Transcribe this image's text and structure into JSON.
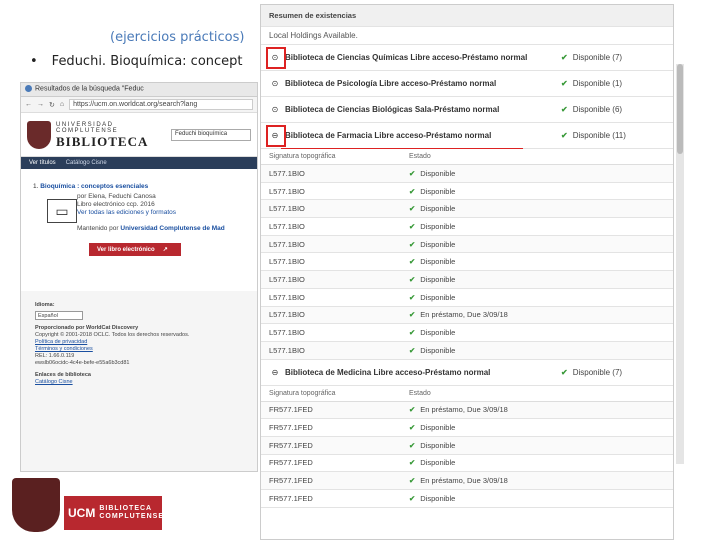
{
  "slide": {
    "heading": "(ejercicios prácticos)",
    "bullet": "Feduchi. Bioquímica: concept"
  },
  "browser": {
    "tab_title": "Resultados de la búsqueda \"Feduc",
    "url": "https://ucm.on.worldcat.org/search?lang",
    "university_line1": "UNIVERSIDAD",
    "university_line2": "COMPLUTENSE",
    "library_word": "BIBLIOTECA",
    "search_value": "Feduchi bioquímica",
    "nav": [
      "Ver títulos",
      "Catálogo Cisne"
    ],
    "result": {
      "number": "1.",
      "title": "Bioquímica : conceptos esenciales",
      "author": "por Elena, Feduchi Canosa",
      "type": "Libro electrónico  ccp. 2016",
      "editions_link": "Ver todas las ediciones y formatos",
      "maintained_prefix": "Mantenido por",
      "maintained_by": "Universidad Complutense de Mad",
      "ebook_button": "Ver libro electrónico"
    },
    "footer": {
      "language_label": "Idioma:",
      "language_value": "Español",
      "provided_label": "Proporcionado por WorldCat Discovery",
      "copyright": "Copyright © 2001-2018 OCLC. Todos los derechos reservados.",
      "privacy": "Política de privacidad",
      "terms": "Términos y condiciones",
      "build": "REL: 1.66.0.119",
      "build2": "ewslb06ocidc-4c4e-befe-e55a6b3cd81",
      "links_label": "Enlaces de biblioteca",
      "catalog_link": "Catálogo Cisne"
    }
  },
  "logos": {
    "ucm": "UCM",
    "biblioteca_line1": "BIBLIOTECA",
    "biblioteca_line2": "COMPLUTENSE"
  },
  "holdings": {
    "title": "Resumen de existencias",
    "local": "Local Holdings Available.",
    "headers": {
      "call": "Signatura topográfica",
      "status": "Estado"
    },
    "libraries": [
      {
        "name": "Biblioteca de Ciencias Químicas Libre acceso-Préstamo normal",
        "availability": "Disponible (7)",
        "toggle": "⊙"
      },
      {
        "name": "Biblioteca de Psicología Libre acceso-Préstamo normal",
        "availability": "Disponible (1)",
        "toggle": "⊙"
      },
      {
        "name": "Biblioteca de Ciencias Biológicas Sala-Préstamo normal",
        "availability": "Disponible (6)",
        "toggle": "⊙"
      },
      {
        "name": "Biblioteca de Farmacia Libre acceso-Préstamo normal",
        "availability": "Disponible (11)",
        "toggle": "⊖"
      },
      {
        "name": "Biblioteca de Medicina Libre acceso-Préstamo normal",
        "availability": "Disponible (7)",
        "toggle": "⊖"
      }
    ],
    "farmacia_copies": [
      {
        "call": "L577.1BIO",
        "status": "Disponible"
      },
      {
        "call": "L577.1BIO",
        "status": "Disponible"
      },
      {
        "call": "L577.1BIO",
        "status": "Disponible"
      },
      {
        "call": "L577.1BIO",
        "status": "Disponible"
      },
      {
        "call": "L577.1BIO",
        "status": "Disponible"
      },
      {
        "call": "L577.1BIO",
        "status": "Disponible"
      },
      {
        "call": "L577.1BIO",
        "status": "Disponible"
      },
      {
        "call": "L577.1BIO",
        "status": "Disponible"
      },
      {
        "call": "L577.1BIO",
        "status": "En préstamo, Due 3/09/18"
      },
      {
        "call": "L577.1BIO",
        "status": "Disponible"
      },
      {
        "call": "L577.1BIO",
        "status": "Disponible"
      }
    ],
    "medicina_copies": [
      {
        "call": "FR577.1FED",
        "status": "En préstamo, Due 3/09/18"
      },
      {
        "call": "FR577.1FED",
        "status": "Disponible"
      },
      {
        "call": "FR577.1FED",
        "status": "Disponible"
      },
      {
        "call": "FR577.1FED",
        "status": "Disponible"
      },
      {
        "call": "FR577.1FED",
        "status": "En préstamo, Due 3/09/18"
      },
      {
        "call": "FR577.1FED",
        "status": "Disponible"
      }
    ]
  },
  "colors": {
    "accent_red": "#b8282f",
    "link_blue": "#1a4fa0",
    "check_green": "#3a9a3a",
    "highlight": "#dd2222"
  }
}
